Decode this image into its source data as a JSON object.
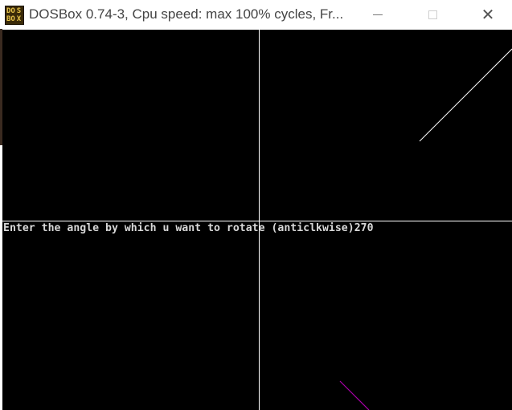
{
  "window": {
    "title": "DOSBox 0.74-3, Cpu speed: max 100% cycles, Fr...",
    "icon_text": [
      "DOS",
      "BOX"
    ],
    "icon": "dosbox-app-icon",
    "controls": {
      "minimize_icon": "minimize-icon",
      "maximize_icon": "maximize-icon",
      "close_icon": "close-icon",
      "close_glyph": "✕"
    }
  },
  "console": {
    "prompt": "Enter the angle by which u want to rotate (anticlkwise)",
    "input": "270"
  },
  "colors": {
    "screen_bg": "#000000",
    "axis_color": "#ffffff",
    "original_line": "#ffffff",
    "rotated_line": "#aa00aa",
    "text": "#d8d8d8"
  }
}
